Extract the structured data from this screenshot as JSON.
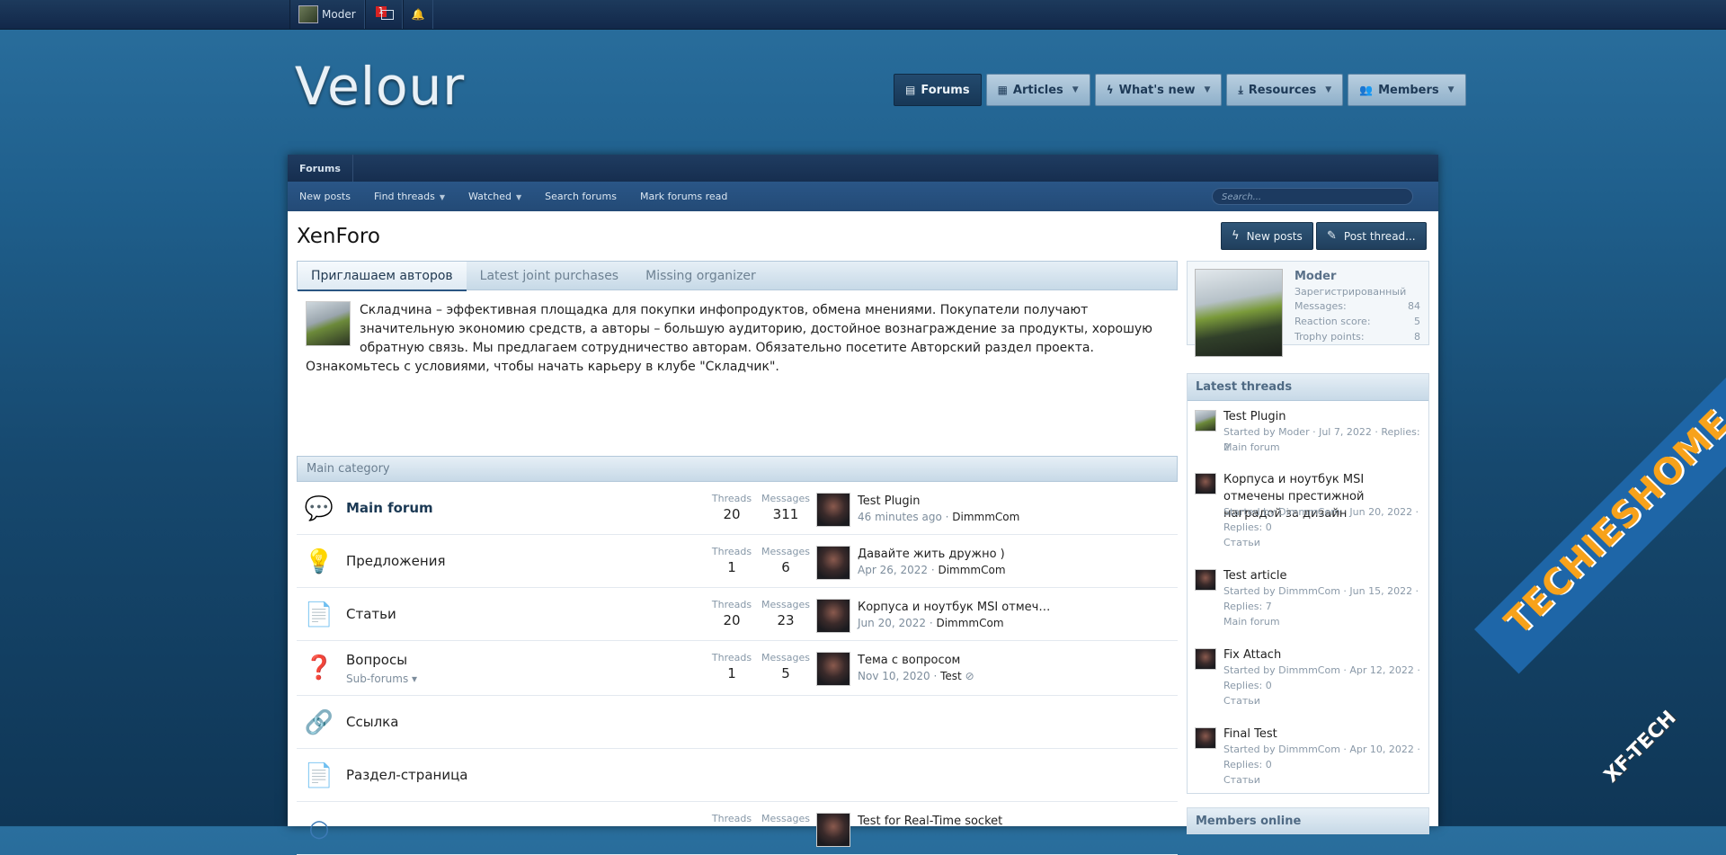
{
  "topbar": {
    "user": "Moder",
    "inbox_count": "1"
  },
  "logo": {
    "text": "Velour"
  },
  "nav": {
    "forums": "Forums",
    "articles": "Articles",
    "whats_new": "What's new",
    "resources": "Resources",
    "members": "Members"
  },
  "breadcrumb": {
    "forums": "Forums"
  },
  "subnav": {
    "new_posts": "New posts",
    "find_threads": "Find threads",
    "watched": "Watched",
    "search_forums": "Search forums",
    "mark_read": "Mark forums read",
    "search_placeholder": "Search..."
  },
  "page": {
    "title": "XenForo",
    "new_posts_btn": "New posts",
    "post_thread_btn": "Post thread..."
  },
  "tabs": {
    "t1": "Приглашаем авторов",
    "t2": "Latest joint purchases",
    "t3": "Missing organizer",
    "content": "Складчина – эффективная площадка для покупки инфопродуктов, обмена мнениями. Покупатели получают значительную экономию средств, а авторы – большую аудиторию, достойное вознаграждение за продукты, хорошую обратную связь. Мы предлагаем сотрудничество авторам. Обязательно посетите Авторский раздел проекта. Ознакомьтесь с условиями, чтобы начать карьеру в клубе \"Складчик\"."
  },
  "category": {
    "title": "Main category"
  },
  "labels": {
    "threads": "Threads",
    "messages": "Messages"
  },
  "nodes": [
    {
      "title": "Main forum",
      "threads": "20",
      "messages": "311",
      "last_title": "Test Plugin",
      "last_date": "46 minutes ago",
      "last_user": "DimmmCom"
    },
    {
      "title": "Предложения",
      "threads": "1",
      "messages": "6",
      "last_title": "Давайте жить дружно )",
      "last_date": "Apr 26, 2022",
      "last_user": "DimmmCom"
    },
    {
      "title": "Статьи",
      "threads": "20",
      "messages": "23",
      "last_title": "Корпуса и ноутбук MSI отмечены престижной наградой за дизайн",
      "last_date": "Jun 20, 2022",
      "last_user": "DimmmCom"
    },
    {
      "title": "Вопросы",
      "subforums": "Sub-forums",
      "threads": "1",
      "messages": "5",
      "last_title": "Тема с вопросом",
      "last_date": "Nov 10, 2020",
      "last_user": "Test"
    },
    {
      "title": "Ссылка"
    },
    {
      "title": "Раздел-страница"
    },
    {
      "threads": "Threads",
      "messages": "Messages",
      "last_title": "Test for Real-Time socket"
    }
  ],
  "sidebar": {
    "user": {
      "name": "Moder",
      "role": "Зарегистрированный",
      "messages_label": "Messages:",
      "messages": "84",
      "reaction_label": "Reaction score:",
      "reaction": "5",
      "trophy_label": "Trophy points:",
      "trophy": "8"
    },
    "latest": {
      "title": "Latest threads",
      "items": [
        {
          "title": "Test Plugin",
          "meta1": "Started by Moder · Jul 7, 2022 · Replies: 2",
          "meta2": "Main forum"
        },
        {
          "title": "Корпуса и ноутбук MSI отмечены престижной наградой за дизайн",
          "meta1": "Started by DimmmCom · Jun 20, 2022 ·",
          "meta2": "Replies: 0",
          "meta3": "Статьи"
        },
        {
          "title": "Test article",
          "meta1": "Started by DimmmCom · Jun 15, 2022 ·",
          "meta2": "Replies: 7",
          "meta3": "Main forum"
        },
        {
          "title": "Fix Attach",
          "meta1": "Started by DimmmCom · Apr 12, 2022 ·",
          "meta2": "Replies: 0",
          "meta3": "Статьи"
        },
        {
          "title": "Final Test",
          "meta1": "Started by DimmmCom · Apr 10, 2022 ·",
          "meta2": "Replies: 0",
          "meta3": "Статьи"
        }
      ]
    },
    "members_online": "Members online"
  },
  "watermark": {
    "text": "TECHIESHOME.COM",
    "sub": "XF-TECH"
  }
}
